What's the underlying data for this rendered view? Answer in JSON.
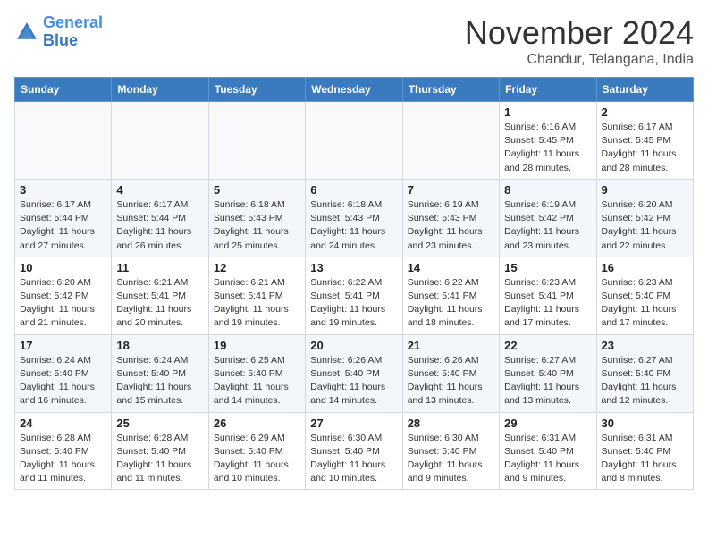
{
  "header": {
    "logo_line1": "General",
    "logo_line2": "Blue",
    "month": "November 2024",
    "location": "Chandur, Telangana, India"
  },
  "weekdays": [
    "Sunday",
    "Monday",
    "Tuesday",
    "Wednesday",
    "Thursday",
    "Friday",
    "Saturday"
  ],
  "weeks": [
    [
      {
        "day": "",
        "info": ""
      },
      {
        "day": "",
        "info": ""
      },
      {
        "day": "",
        "info": ""
      },
      {
        "day": "",
        "info": ""
      },
      {
        "day": "",
        "info": ""
      },
      {
        "day": "1",
        "info": "Sunrise: 6:16 AM\nSunset: 5:45 PM\nDaylight: 11 hours and 28 minutes."
      },
      {
        "day": "2",
        "info": "Sunrise: 6:17 AM\nSunset: 5:45 PM\nDaylight: 11 hours and 28 minutes."
      }
    ],
    [
      {
        "day": "3",
        "info": "Sunrise: 6:17 AM\nSunset: 5:44 PM\nDaylight: 11 hours and 27 minutes."
      },
      {
        "day": "4",
        "info": "Sunrise: 6:17 AM\nSunset: 5:44 PM\nDaylight: 11 hours and 26 minutes."
      },
      {
        "day": "5",
        "info": "Sunrise: 6:18 AM\nSunset: 5:43 PM\nDaylight: 11 hours and 25 minutes."
      },
      {
        "day": "6",
        "info": "Sunrise: 6:18 AM\nSunset: 5:43 PM\nDaylight: 11 hours and 24 minutes."
      },
      {
        "day": "7",
        "info": "Sunrise: 6:19 AM\nSunset: 5:43 PM\nDaylight: 11 hours and 23 minutes."
      },
      {
        "day": "8",
        "info": "Sunrise: 6:19 AM\nSunset: 5:42 PM\nDaylight: 11 hours and 23 minutes."
      },
      {
        "day": "9",
        "info": "Sunrise: 6:20 AM\nSunset: 5:42 PM\nDaylight: 11 hours and 22 minutes."
      }
    ],
    [
      {
        "day": "10",
        "info": "Sunrise: 6:20 AM\nSunset: 5:42 PM\nDaylight: 11 hours and 21 minutes."
      },
      {
        "day": "11",
        "info": "Sunrise: 6:21 AM\nSunset: 5:41 PM\nDaylight: 11 hours and 20 minutes."
      },
      {
        "day": "12",
        "info": "Sunrise: 6:21 AM\nSunset: 5:41 PM\nDaylight: 11 hours and 19 minutes."
      },
      {
        "day": "13",
        "info": "Sunrise: 6:22 AM\nSunset: 5:41 PM\nDaylight: 11 hours and 19 minutes."
      },
      {
        "day": "14",
        "info": "Sunrise: 6:22 AM\nSunset: 5:41 PM\nDaylight: 11 hours and 18 minutes."
      },
      {
        "day": "15",
        "info": "Sunrise: 6:23 AM\nSunset: 5:41 PM\nDaylight: 11 hours and 17 minutes."
      },
      {
        "day": "16",
        "info": "Sunrise: 6:23 AM\nSunset: 5:40 PM\nDaylight: 11 hours and 17 minutes."
      }
    ],
    [
      {
        "day": "17",
        "info": "Sunrise: 6:24 AM\nSunset: 5:40 PM\nDaylight: 11 hours and 16 minutes."
      },
      {
        "day": "18",
        "info": "Sunrise: 6:24 AM\nSunset: 5:40 PM\nDaylight: 11 hours and 15 minutes."
      },
      {
        "day": "19",
        "info": "Sunrise: 6:25 AM\nSunset: 5:40 PM\nDaylight: 11 hours and 14 minutes."
      },
      {
        "day": "20",
        "info": "Sunrise: 6:26 AM\nSunset: 5:40 PM\nDaylight: 11 hours and 14 minutes."
      },
      {
        "day": "21",
        "info": "Sunrise: 6:26 AM\nSunset: 5:40 PM\nDaylight: 11 hours and 13 minutes."
      },
      {
        "day": "22",
        "info": "Sunrise: 6:27 AM\nSunset: 5:40 PM\nDaylight: 11 hours and 13 minutes."
      },
      {
        "day": "23",
        "info": "Sunrise: 6:27 AM\nSunset: 5:40 PM\nDaylight: 11 hours and 12 minutes."
      }
    ],
    [
      {
        "day": "24",
        "info": "Sunrise: 6:28 AM\nSunset: 5:40 PM\nDaylight: 11 hours and 11 minutes."
      },
      {
        "day": "25",
        "info": "Sunrise: 6:28 AM\nSunset: 5:40 PM\nDaylight: 11 hours and 11 minutes."
      },
      {
        "day": "26",
        "info": "Sunrise: 6:29 AM\nSunset: 5:40 PM\nDaylight: 11 hours and 10 minutes."
      },
      {
        "day": "27",
        "info": "Sunrise: 6:30 AM\nSunset: 5:40 PM\nDaylight: 11 hours and 10 minutes."
      },
      {
        "day": "28",
        "info": "Sunrise: 6:30 AM\nSunset: 5:40 PM\nDaylight: 11 hours and 9 minutes."
      },
      {
        "day": "29",
        "info": "Sunrise: 6:31 AM\nSunset: 5:40 PM\nDaylight: 11 hours and 9 minutes."
      },
      {
        "day": "30",
        "info": "Sunrise: 6:31 AM\nSunset: 5:40 PM\nDaylight: 11 hours and 8 minutes."
      }
    ]
  ]
}
